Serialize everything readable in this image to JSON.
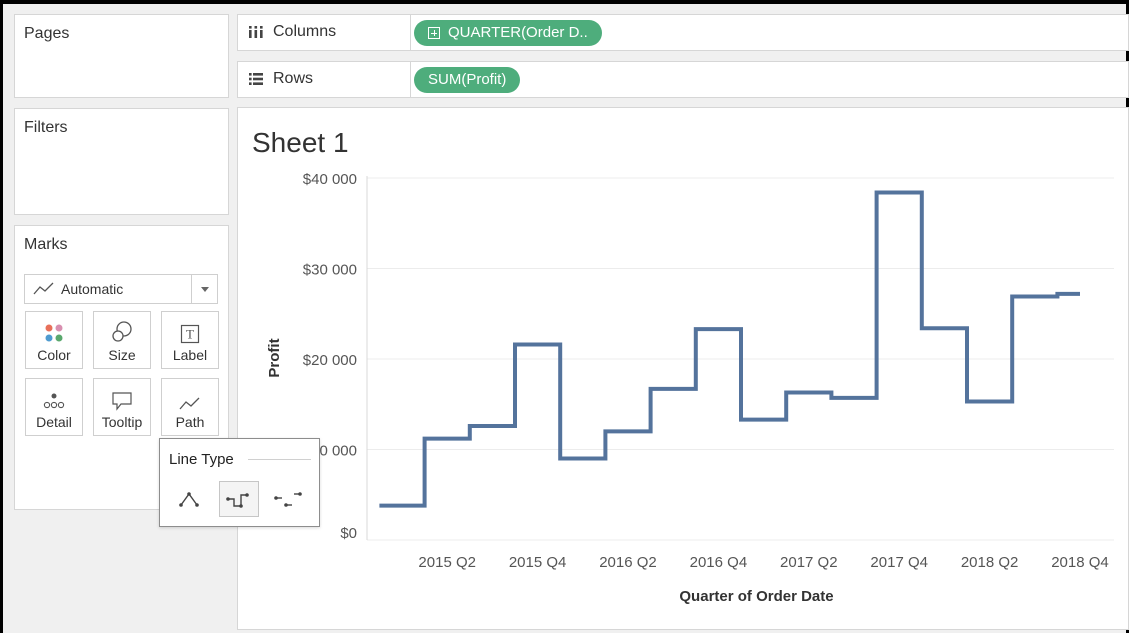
{
  "panels": {
    "pages_title": "Pages",
    "filters_title": "Filters",
    "marks_title": "Marks"
  },
  "shelves": {
    "columns_label": "Columns",
    "columns_pill": "QUARTER(Order D..",
    "rows_label": "Rows",
    "rows_pill": "SUM(Profit)"
  },
  "marks": {
    "type_selected": "Automatic",
    "buttons": [
      {
        "label": "Color",
        "icon": "color-dots-icon"
      },
      {
        "label": "Size",
        "icon": "size-icon"
      },
      {
        "label": "Label",
        "icon": "label-icon"
      },
      {
        "label": "Detail",
        "icon": "detail-icon"
      },
      {
        "label": "Tooltip",
        "icon": "tooltip-icon"
      },
      {
        "label": "Path",
        "icon": "path-icon"
      }
    ]
  },
  "line_type_popup": {
    "title": "Line Type",
    "options": [
      "linear-icon",
      "step-icon",
      "jump-icon"
    ],
    "selected": "step-icon"
  },
  "sheet": {
    "title": "Sheet 1"
  },
  "colors": {
    "pill": "#4ead7c",
    "line": "#54739c"
  },
  "chart_data": {
    "type": "line",
    "line_style": "step",
    "xlabel": "Quarter of Order Date",
    "ylabel": "Profit",
    "x": [
      "2015 Q1",
      "2015 Q2",
      "2015 Q3",
      "2015 Q4",
      "2016 Q1",
      "2016 Q2",
      "2016 Q3",
      "2016 Q4",
      "2017 Q1",
      "2017 Q2",
      "2017 Q3",
      "2017 Q4",
      "2018 Q1",
      "2018 Q2",
      "2018 Q3",
      "2018 Q4"
    ],
    "x_tick_labels": [
      "2015 Q2",
      "2015 Q4",
      "2016 Q2",
      "2016 Q4",
      "2017 Q2",
      "2017 Q4",
      "2018 Q2",
      "2018 Q4"
    ],
    "series": [
      {
        "values": [
          3800,
          11200,
          12600,
          21600,
          9000,
          12000,
          16700,
          23300,
          13300,
          16300,
          15700,
          38400,
          23400,
          15300,
          26900,
          27200
        ]
      }
    ],
    "y_ticks": [
      0,
      10000,
      20000,
      30000,
      40000
    ],
    "y_tick_labels": [
      "$0",
      "$10 000",
      "$20 000",
      "$30 000",
      "$40 000"
    ],
    "ylim": [
      0,
      40000
    ],
    "grid": true
  }
}
